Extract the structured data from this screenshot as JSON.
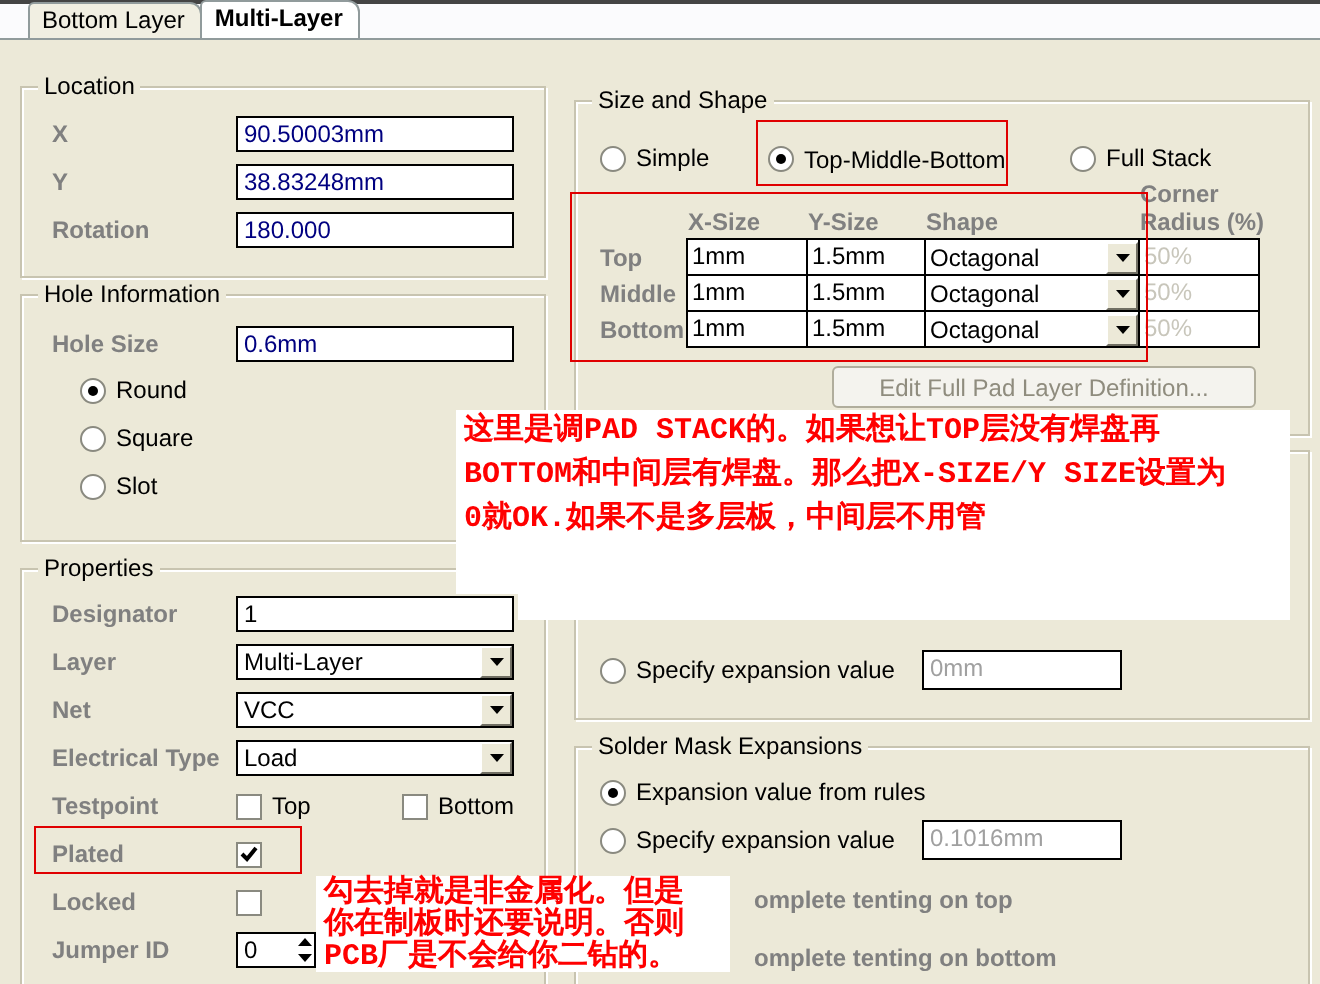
{
  "tabs": [
    {
      "label": "Bottom Layer",
      "selected": false
    },
    {
      "label": "Multi-Layer",
      "selected": true
    }
  ],
  "location": {
    "title": "Location",
    "fields": [
      {
        "label": "X",
        "value": "90.50003mm"
      },
      {
        "label": "Y",
        "value": "38.83248mm"
      },
      {
        "label": "Rotation",
        "value": "180.000"
      }
    ]
  },
  "hole_information": {
    "title": "Hole Information",
    "fields": [
      {
        "label": "Hole Size",
        "value": "0.6mm"
      }
    ],
    "shapes": [
      {
        "label": "Round",
        "selected": true
      },
      {
        "label": "Square",
        "selected": false
      },
      {
        "label": "Slot",
        "selected": false
      }
    ]
  },
  "properties": {
    "title": "Properties",
    "rows": [
      {
        "kind": "text",
        "label": "Designator",
        "value": "1"
      },
      {
        "kind": "dropdown",
        "label": "Layer",
        "value": "Multi-Layer"
      },
      {
        "kind": "dropdown",
        "label": "Net",
        "value": "VCC"
      },
      {
        "kind": "dropdown",
        "label": "Electrical Type",
        "value": "Load"
      },
      {
        "kind": "checks",
        "label": "Testpoint",
        "options": [
          {
            "label": "Top",
            "checked": false
          },
          {
            "label": "Bottom",
            "checked": false
          }
        ]
      },
      {
        "kind": "check",
        "label": "Plated",
        "checked": true,
        "highlighted": true
      },
      {
        "kind": "check",
        "label": "Locked",
        "checked": false,
        "highlighted": false
      },
      {
        "kind": "spinner",
        "label": "Jumper ID",
        "value": "0"
      }
    ]
  },
  "size_and_shape": {
    "title": "Size and Shape",
    "modes": [
      {
        "label": "Simple",
        "selected": false,
        "highlighted": false
      },
      {
        "label": "Top-Middle-Bottom",
        "selected": true,
        "highlighted": true
      },
      {
        "label": "Full Stack",
        "selected": false,
        "highlighted": false
      }
    ],
    "table": {
      "highlighted": true,
      "columns": [
        "X-Size",
        "Y-Size",
        "Shape",
        "Corner Radius (%)"
      ],
      "rows": [
        {
          "layer": "Top",
          "x_size": "1mm",
          "y_size": "1.5mm",
          "shape": "Octagonal",
          "corner_radius": "50%",
          "corner_radius_disabled": true
        },
        {
          "layer": "Middle",
          "x_size": "1mm",
          "y_size": "1.5mm",
          "shape": "Octagonal",
          "corner_radius": "50%",
          "corner_radius_disabled": true
        },
        {
          "layer": "Bottom",
          "x_size": "1mm",
          "y_size": "1.5mm",
          "shape": "Octagonal",
          "corner_radius": "50%",
          "corner_radius_disabled": true
        }
      ]
    },
    "edit_button": {
      "label": "Edit Full Pad Layer Definition...",
      "disabled": true
    }
  },
  "paste_mask": {
    "options": [
      {
        "label": "Specify expansion value",
        "selected": false,
        "value": "0mm",
        "disabled": true
      }
    ]
  },
  "solder_mask": {
    "title": "Solder Mask Expansions",
    "options": [
      {
        "label": "Expansion value from rules",
        "selected": true
      },
      {
        "label": "Specify expansion value",
        "selected": false,
        "value": "0.1016mm",
        "disabled": true
      }
    ],
    "tenting": [
      {
        "label": "omplete tenting on top"
      },
      {
        "label": "omplete tenting on bottom"
      }
    ]
  },
  "annotations": [
    {
      "lines": [
        "这里是调PAD STACK的。如果想让TOP层没有焊盘再",
        "BOTTOM和中间层有焊盘。那么把X-SIZE/Y SIZE设置为",
        "0就OK.如果不是多层板，中间层不用管"
      ]
    },
    {
      "lines": [
        "勾去掉就是非金属化。但是",
        "你在制板时还要说明。否则",
        "PCB厂是不会给你二钻的。"
      ]
    }
  ]
}
